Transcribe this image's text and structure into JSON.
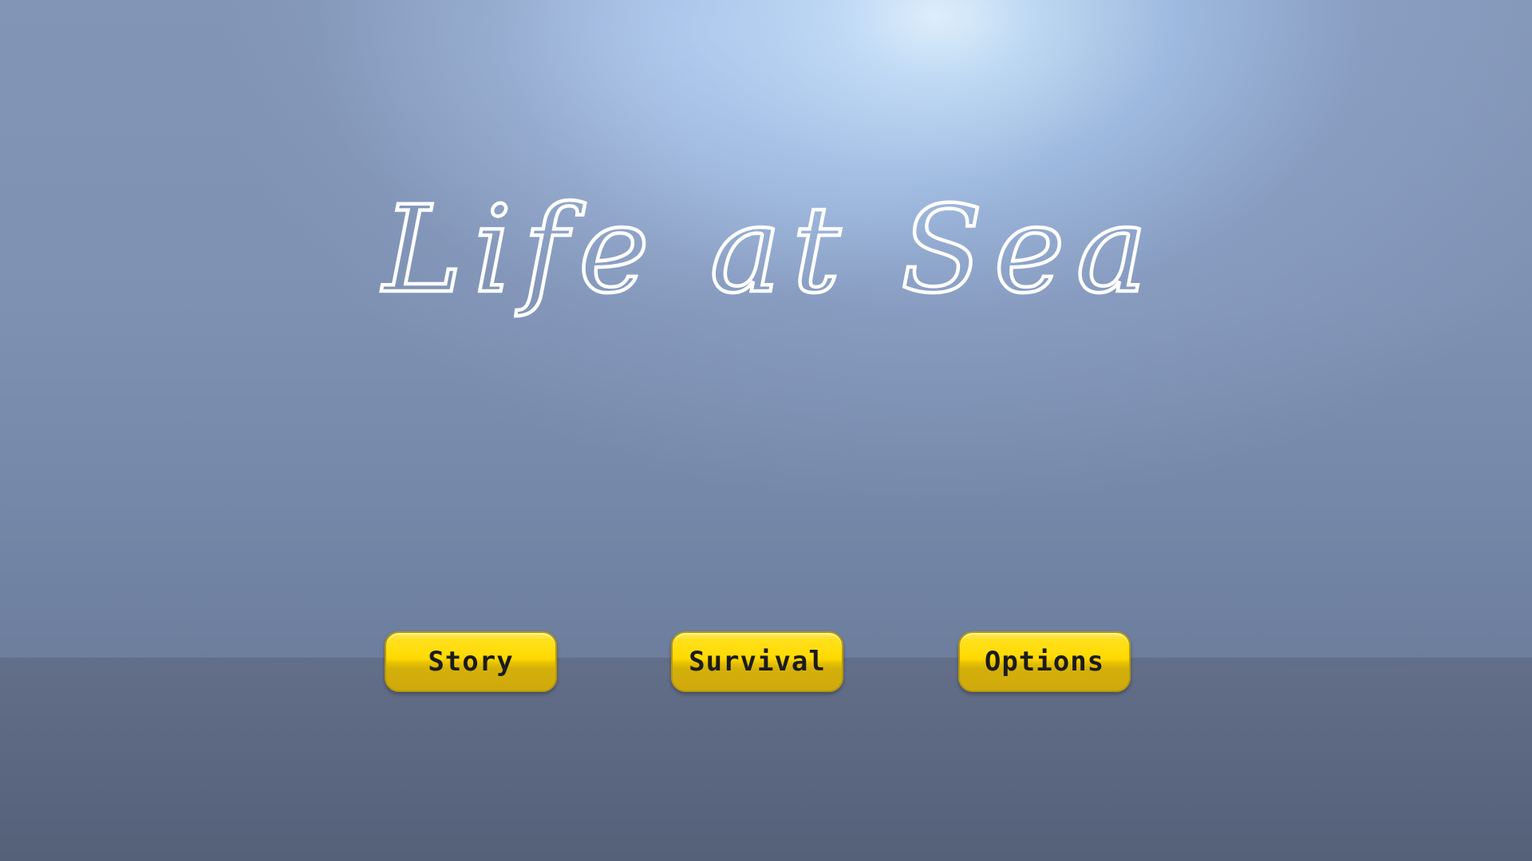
{
  "game": {
    "title": "Life at Sea"
  },
  "menu": {
    "buttons": [
      {
        "label": "Story"
      },
      {
        "label": "Survival"
      },
      {
        "label": "Options"
      }
    ]
  },
  "colors": {
    "button_fill": "#ffd900",
    "button_border": "#b89a06",
    "button_text": "#1b1b1b",
    "title_stroke": "#ffffff",
    "sky": "#8295b6",
    "sea": "#5d6883"
  }
}
